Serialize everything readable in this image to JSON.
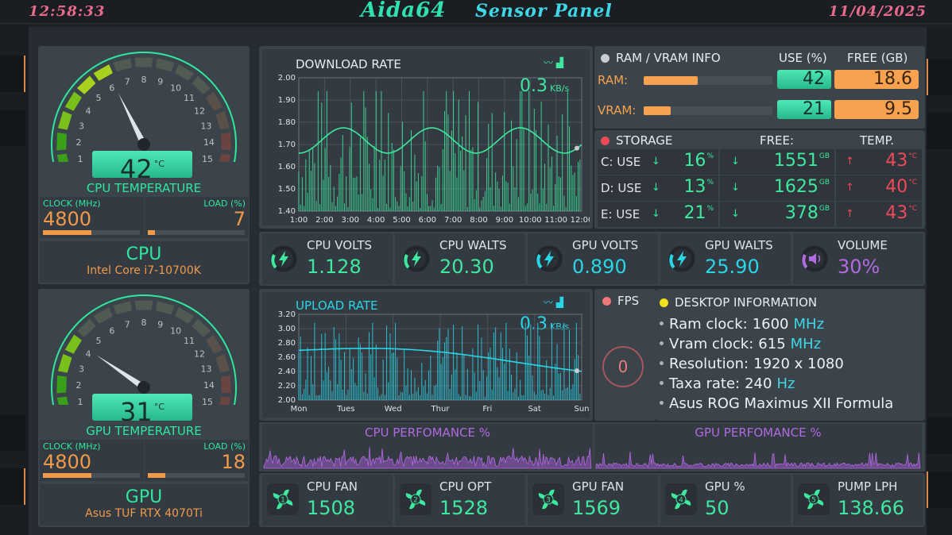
{
  "header": {
    "time": "12:58:33",
    "title": "Aida64",
    "subtitle": "Sensor Panel",
    "date": "11/04/2025"
  },
  "cpu": {
    "gauge_ticks": [
      "1",
      "2",
      "3",
      "4",
      "5",
      "6",
      "7",
      "8",
      "9",
      "10",
      "11",
      "12",
      "13",
      "14",
      "15"
    ],
    "temp": "42",
    "temp_unit": "°C",
    "temp_label": "CPU TEMPERATURE",
    "clock_label": "CLOCK (MHz)",
    "clock": "4800",
    "clock_fill": 0.5,
    "load_label": "LOAD (%)",
    "load": "7",
    "load_fill": 0.07,
    "name": "CPU",
    "model": "Intel Core i7-10700K",
    "gauge_value": 6
  },
  "gpu": {
    "gauge_ticks": [
      "1",
      "2",
      "3",
      "4",
      "5",
      "6",
      "7",
      "8",
      "9",
      "10",
      "11",
      "12",
      "13",
      "14",
      "15"
    ],
    "temp": "31",
    "temp_unit": "°C",
    "temp_label": "GPU TEMPERATURE",
    "clock_label": "CLOCK (MHz)",
    "clock": "4800",
    "clock_fill": 0.5,
    "load_label": "LOAD (%)",
    "load": "18",
    "load_fill": 0.18,
    "name": "GPU",
    "model": "Asus TUF RTX 4070Ti",
    "gauge_value": 4
  },
  "download": {
    "title": "DOWNLOAD RATE",
    "value": "0.3",
    "unit": "KB/s",
    "color": "#3ee8a0",
    "yticks": [
      "2.00",
      "1.90",
      "1.80",
      "1.70",
      "1.60",
      "1.50",
      "1.40"
    ],
    "xticks": [
      "1:00",
      "2:00",
      "3:00",
      "4:00",
      "5:00",
      "6:00",
      "7:00",
      "8:00",
      "9:00",
      "10:00",
      "11:00",
      "12:00"
    ]
  },
  "upload": {
    "title": "UPLOAD RATE",
    "value": "0.3",
    "unit": "KB/s",
    "color": "#2ad6e6",
    "yticks": [
      "3.20",
      "3.00",
      "2.80",
      "2.60",
      "2.40",
      "2.20",
      "2.00"
    ],
    "xticks": [
      "Mon",
      "Tues",
      "Wed",
      "Thur",
      "Fri",
      "Sat",
      "Sun"
    ]
  },
  "memory": {
    "title": "RAM / VRAM INFO",
    "use_hdr": "USE (%)",
    "free_hdr": "FREE (GB)",
    "rows": [
      {
        "label": "RAM:",
        "use": "42",
        "free": "18.6",
        "fill": 0.42
      },
      {
        "label": "VRAM:",
        "use": "21",
        "free": "9.5",
        "fill": 0.21
      }
    ]
  },
  "storage": {
    "title": "STORAGE",
    "free_hdr": "FREE:",
    "temp_hdr": "TEMP.",
    "rows": [
      {
        "label": "C: USE",
        "use": "16",
        "use_unit": "%",
        "free": "1551",
        "free_unit": "GB",
        "temp": "43",
        "temp_unit": "°C"
      },
      {
        "label": "D: USE",
        "use": "13",
        "use_unit": "%",
        "free": "1625",
        "free_unit": "GB",
        "temp": "40",
        "temp_unit": "°C"
      },
      {
        "label": "E: USE",
        "use": "21",
        "use_unit": "%",
        "free": "378",
        "free_unit": "GB",
        "temp": "43",
        "temp_unit": "°C"
      }
    ]
  },
  "tiles": [
    {
      "label": "CPU VOLTS",
      "value": "1.128",
      "color": "#3ee8a0",
      "icon": "bolt-icon"
    },
    {
      "label": "CPU WALTS",
      "value": "20.30",
      "color": "#3ee8a0",
      "icon": "bolt-icon"
    },
    {
      "label": "GPU VOLTS",
      "value": "0.890",
      "color": "#2ad6e6",
      "icon": "bolt-icon"
    },
    {
      "label": "GPU WALTS",
      "value": "25.90",
      "color": "#2ad6e6",
      "icon": "bolt-icon"
    },
    {
      "label": "VOLUME",
      "value": "30%",
      "color": "#b06be0",
      "icon": "speaker-icon"
    }
  ],
  "fps": {
    "label": "FPS",
    "value": "0"
  },
  "desktop": {
    "title": "DESKTOP INFORMATION",
    "items": [
      {
        "label": "Ram clock:",
        "value": "1600",
        "unit": "MHz"
      },
      {
        "label": "Vram clock:",
        "value": "615",
        "unit": "MHz"
      },
      {
        "label": "Resolution:",
        "value": "1920 x 1080",
        "unit": ""
      },
      {
        "label": "Taxa rate:",
        "value": "240",
        "unit": "Hz"
      },
      {
        "label": "Asus ROG Maximus XII Formula",
        "value": "",
        "unit": ""
      }
    ]
  },
  "perf": {
    "cpu_label": "CPU PERFOMANCE %",
    "gpu_label": "GPU PERFOMANCE %"
  },
  "fans": [
    {
      "num": "1",
      "label": "CPU FAN",
      "value": "1508"
    },
    {
      "num": "2",
      "label": "CPU OPT",
      "value": "1528"
    },
    {
      "num": "3",
      "label": "GPU FAN",
      "value": "1569"
    },
    {
      "num": "4",
      "label": "GPU %",
      "value": "50"
    },
    {
      "num": "5",
      "label": "PUMP LPH",
      "value": "138.66"
    }
  ]
}
